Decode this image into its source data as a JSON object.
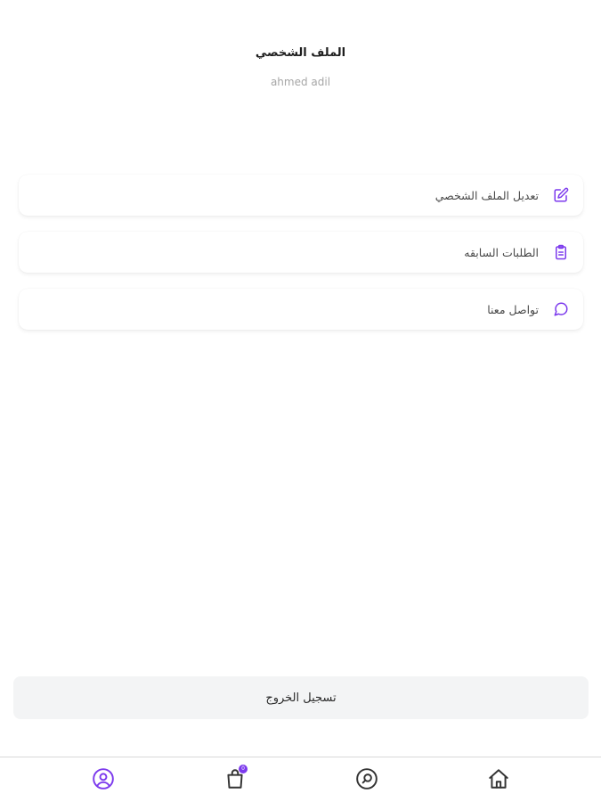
{
  "header": {
    "title": "الملف الشخصي",
    "username": "ahmed adil"
  },
  "menu": {
    "items": [
      {
        "label": "تعديل الملف الشخصي",
        "icon": "edit-icon"
      },
      {
        "label": "الطلبات السابقه",
        "icon": "clipboard-icon"
      },
      {
        "label": "تواصل معنا",
        "icon": "chat-icon"
      }
    ]
  },
  "logout": {
    "label": "تسجيل الخروج"
  },
  "bottom_nav": {
    "items": [
      {
        "icon": "profile-icon",
        "active": true
      },
      {
        "icon": "bag-icon",
        "badge": "0"
      },
      {
        "icon": "search-icon"
      },
      {
        "icon": "home-icon"
      }
    ]
  },
  "colors": {
    "accent": "#7c3aed",
    "icon_default": "#333333",
    "logout_bg": "#f3f4f5"
  }
}
